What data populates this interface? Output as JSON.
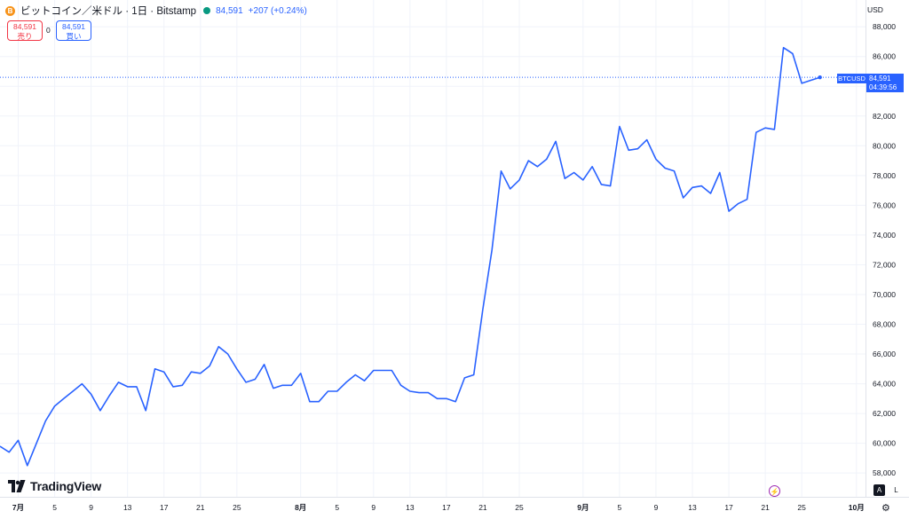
{
  "header": {
    "coin_icon": "B",
    "title": "ビットコイン／米ドル · 1日 · Bitstamp",
    "price": "84,591",
    "change": "+207 (+0.24%)"
  },
  "trade": {
    "sell_price": "84,591",
    "sell_label": "売り",
    "spread": "0",
    "buy_price": "84,591",
    "buy_label": "買い"
  },
  "currency": "USD",
  "last_price_label": {
    "symbol": "BTCUSD",
    "price": "84,591",
    "countdown": "04:39:56"
  },
  "logo_text": "TradingView",
  "controls": {
    "auto": "A",
    "log": "L"
  },
  "icons": [
    "bitcoin-icon",
    "market-status-icon",
    "tradingview-logo-icon",
    "flash-icon",
    "settings-icon"
  ],
  "colors": {
    "line": "#2962ff",
    "sell": "#f23645",
    "buy": "#2962ff",
    "grid": "#f0f3fa"
  },
  "chart_data": {
    "type": "line",
    "symbol": "BTCUSD",
    "y_ticks": [
      58000,
      60000,
      62000,
      64000,
      66000,
      68000,
      70000,
      72000,
      74000,
      76000,
      78000,
      80000,
      82000,
      84000,
      86000,
      88000
    ],
    "y_tick_labels": [
      "58,000",
      "60,000",
      "62,000",
      "64,000",
      "66,000",
      "68,000",
      "70,000",
      "72,000",
      "74,000",
      "76,000",
      "78,000",
      "80,000",
      "82,000",
      "84,000",
      "86,000",
      "88,000"
    ],
    "ylim": [
      56400,
      89800
    ],
    "x_start": "2025-06-29",
    "x_end": "2025-10-02",
    "x_ticks": [
      {
        "date": "2025-07-01",
        "label": "7月"
      },
      {
        "date": "2025-07-05",
        "label": "5"
      },
      {
        "date": "2025-07-09",
        "label": "9"
      },
      {
        "date": "2025-07-13",
        "label": "13"
      },
      {
        "date": "2025-07-17",
        "label": "17"
      },
      {
        "date": "2025-07-21",
        "label": "21"
      },
      {
        "date": "2025-07-25",
        "label": "25"
      },
      {
        "date": "2025-08-01",
        "label": "8月"
      },
      {
        "date": "2025-08-05",
        "label": "5"
      },
      {
        "date": "2025-08-09",
        "label": "9"
      },
      {
        "date": "2025-08-13",
        "label": "13"
      },
      {
        "date": "2025-08-17",
        "label": "17"
      },
      {
        "date": "2025-08-21",
        "label": "21"
      },
      {
        "date": "2025-08-25",
        "label": "25"
      },
      {
        "date": "2025-09-01",
        "label": "9月"
      },
      {
        "date": "2025-09-05",
        "label": "5"
      },
      {
        "date": "2025-09-09",
        "label": "9"
      },
      {
        "date": "2025-09-13",
        "label": "13"
      },
      {
        "date": "2025-09-17",
        "label": "17"
      },
      {
        "date": "2025-09-21",
        "label": "21"
      },
      {
        "date": "2025-09-25",
        "label": "25"
      },
      {
        "date": "2025-10-01",
        "label": "10月"
      }
    ],
    "series": [
      {
        "start_date": "2025-06-29",
        "values": [
          59800,
          59400,
          60200,
          58500,
          60000,
          61500,
          62500,
          63000,
          63500,
          64000,
          63300,
          62200,
          63200,
          64100,
          63800,
          63800,
          62200,
          65000,
          64800,
          63800,
          63900,
          64800,
          64700,
          65200,
          66500,
          66000,
          65000,
          64100,
          64300,
          65300,
          63700,
          63900,
          63900,
          64700,
          62800,
          62800,
          63500,
          63500,
          64100,
          64600,
          64200,
          64900,
          64900,
          64900,
          63900,
          63500,
          63400,
          63400,
          63000,
          63000,
          62800,
          64400,
          64600,
          69000,
          73000,
          78300,
          77100,
          77700,
          79000,
          78600,
          79100,
          80300,
          77800,
          78200,
          77700,
          78600,
          77400,
          77300,
          81300,
          79700,
          79800,
          80400,
          79100,
          78500,
          78300,
          76500,
          77200,
          77300,
          76800,
          78200,
          75600,
          76100,
          76400,
          80900,
          81200,
          81100,
          86600,
          86200,
          84200,
          84400,
          84600
        ]
      }
    ]
  }
}
